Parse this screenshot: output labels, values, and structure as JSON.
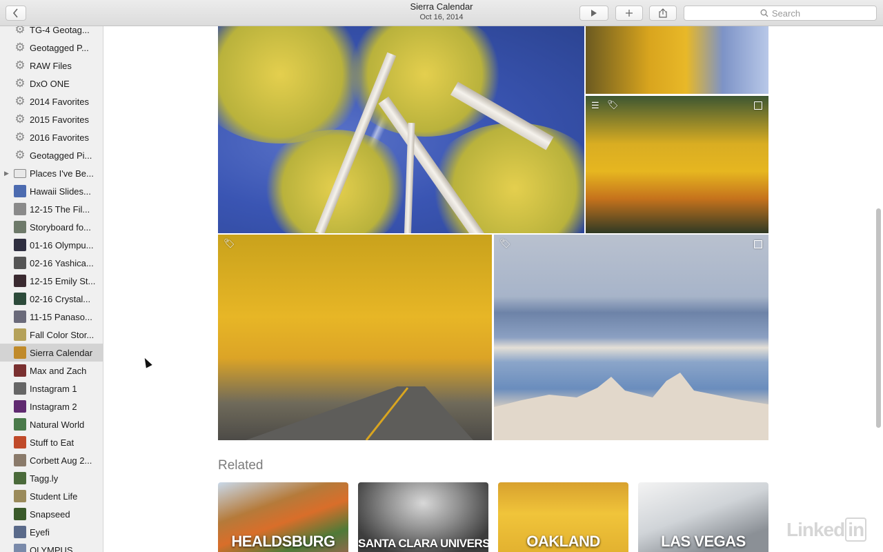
{
  "toolbar": {
    "title": "Sierra Calendar",
    "subtitle": "Oct 16, 2014",
    "search_placeholder": "Search",
    "back_icon": "chevron-left-icon",
    "play_icon": "play-icon",
    "add_icon": "plus-icon",
    "share_icon": "share-icon"
  },
  "sidebar": {
    "items": [
      {
        "label": "TG-4 Geotag...",
        "icon": "gear-icon"
      },
      {
        "label": "Geotagged P...",
        "icon": "gear-icon"
      },
      {
        "label": "RAW Files",
        "icon": "gear-icon"
      },
      {
        "label": "DxO ONE",
        "icon": "gear-icon"
      },
      {
        "label": "2014 Favorites",
        "icon": "gear-icon"
      },
      {
        "label": "2015 Favorites",
        "icon": "gear-icon"
      },
      {
        "label": "2016 Favorites",
        "icon": "gear-icon"
      },
      {
        "label": "Geotagged Pi...",
        "icon": "gear-icon"
      },
      {
        "label": "Places I've Be...",
        "icon": "folder-icon"
      },
      {
        "label": "Hawaii Slides...",
        "icon": "thumbnail"
      },
      {
        "label": "12-15 The Fil...",
        "icon": "thumbnail"
      },
      {
        "label": "Storyboard fo...",
        "icon": "thumbnail"
      },
      {
        "label": "01-16 Olympu...",
        "icon": "thumbnail"
      },
      {
        "label": "02-16 Yashica...",
        "icon": "thumbnail"
      },
      {
        "label": "12-15 Emily St...",
        "icon": "thumbnail"
      },
      {
        "label": "02-16 Crystal...",
        "icon": "thumbnail"
      },
      {
        "label": "11-15 Panaso...",
        "icon": "thumbnail"
      },
      {
        "label": "Fall Color Stor...",
        "icon": "thumbnail"
      },
      {
        "label": "Sierra Calendar",
        "icon": "thumbnail",
        "selected": true
      },
      {
        "label": "Max and Zach",
        "icon": "thumbnail"
      },
      {
        "label": "Instagram 1",
        "icon": "thumbnail"
      },
      {
        "label": "Instagram 2",
        "icon": "thumbnail"
      },
      {
        "label": "Natural World",
        "icon": "thumbnail"
      },
      {
        "label": "Stuff to Eat",
        "icon": "thumbnail"
      },
      {
        "label": "Corbett Aug 2...",
        "icon": "thumbnail"
      },
      {
        "label": "Tagg.ly",
        "icon": "thumbnail"
      },
      {
        "label": "Student Life",
        "icon": "thumbnail"
      },
      {
        "label": "Snapseed",
        "icon": "thumbnail"
      },
      {
        "label": "Eyefi",
        "icon": "thumbnail"
      },
      {
        "label": "OLYMPUS",
        "icon": "thumbnail"
      }
    ],
    "thumb_colors": [
      "#4c6bb0",
      "#8a8a8a",
      "#6e7a6a",
      "#2f2f40",
      "#555555",
      "#3a2a30",
      "#2c4a3a",
      "#6a6a7a",
      "#b5a25a",
      "#c08a2a",
      "#7a3030",
      "#666666",
      "#602a70",
      "#4a7a4a",
      "#c04a2a",
      "#8a7a6a",
      "#4a6a3a",
      "#9a8a5a",
      "#3a5a2a",
      "#5a6a8a",
      "#7a8aaa"
    ]
  },
  "main": {
    "related_title": "Related",
    "related": [
      {
        "label": "HEALDSBURG"
      },
      {
        "label": "SANTA CLARA UNIVERSITY"
      },
      {
        "label": "OAKLAND"
      },
      {
        "label": "LAS VEGAS"
      }
    ],
    "watermark": "Linked",
    "watermark_in": "in"
  }
}
